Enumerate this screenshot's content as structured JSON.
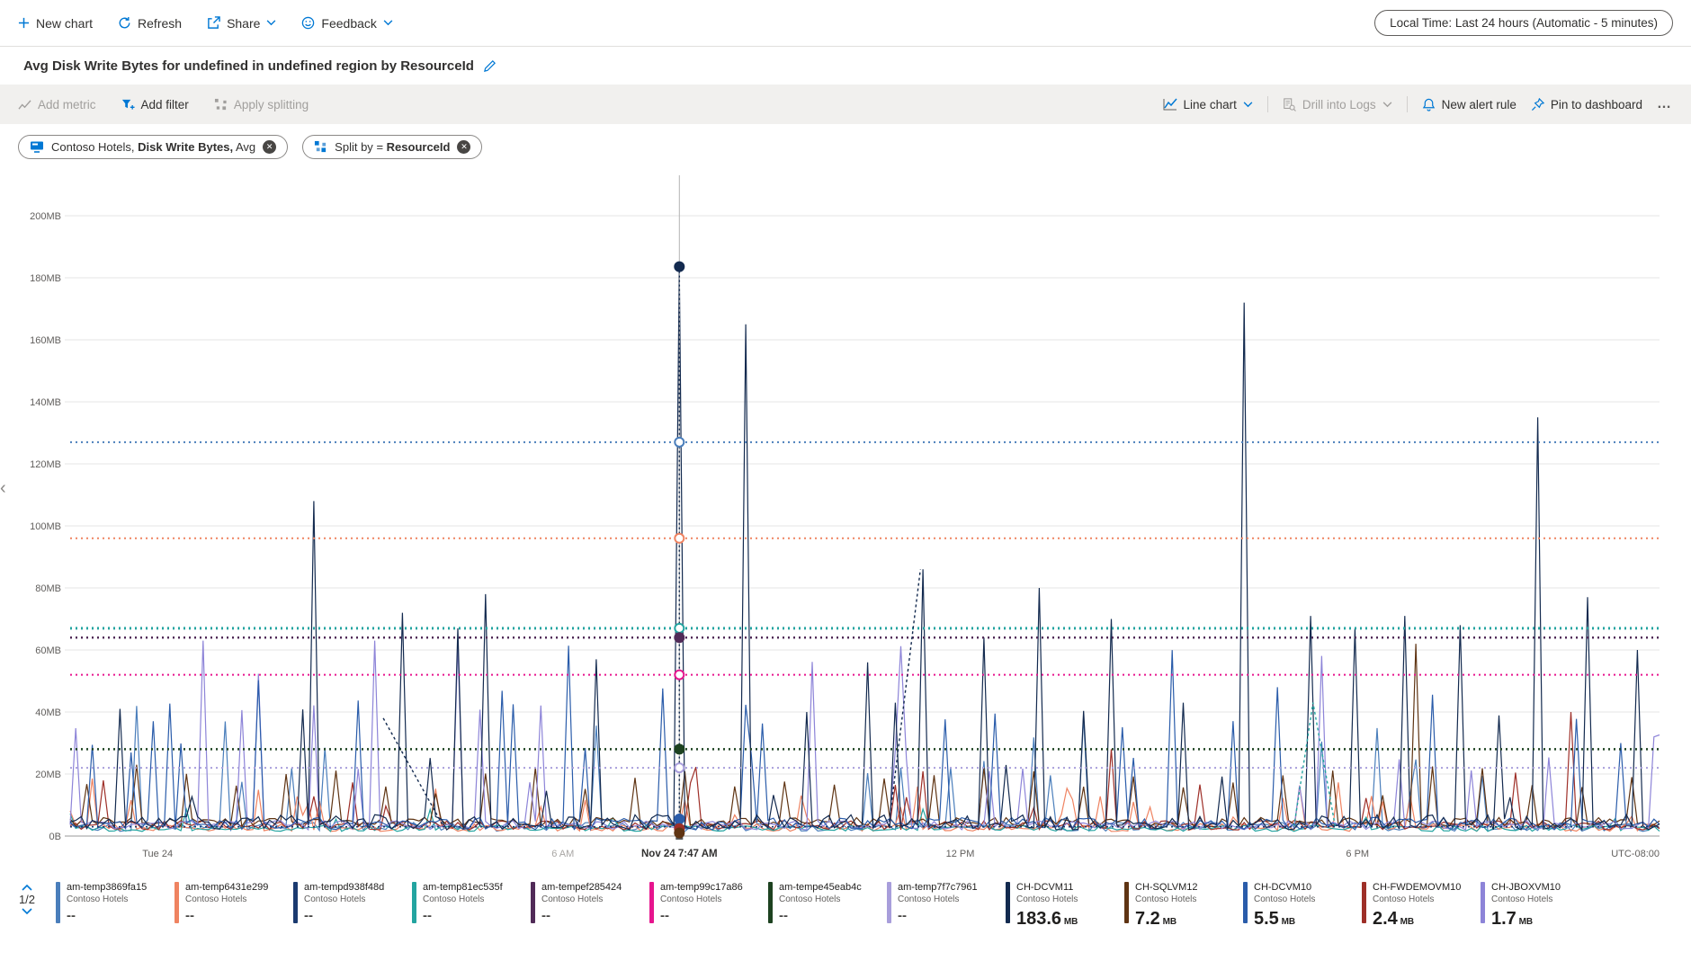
{
  "toolbar": {
    "new_chart": "New chart",
    "refresh": "Refresh",
    "share": "Share",
    "feedback": "Feedback",
    "time_range": "Local Time: Last 24 hours (Automatic - 5 minutes)"
  },
  "title": "Avg Disk Write Bytes for undefined in undefined region by ResourceId",
  "chart_toolbar": {
    "add_metric": "Add metric",
    "add_filter": "Add filter",
    "apply_splitting": "Apply splitting",
    "chart_type": "Line chart",
    "drill_into_logs": "Drill into Logs",
    "new_alert_rule": "New alert rule",
    "pin_to_dashboard": "Pin to dashboard",
    "more": "…"
  },
  "filters": {
    "metric_pill": {
      "scope": "Contoso Hotels,",
      "metric": "Disk Write Bytes,",
      "aggregation": "Avg"
    },
    "split_pill": {
      "label": "Split by",
      "operator": "=",
      "value": "ResourceId"
    }
  },
  "misc": {
    "left_chevron": "‹"
  },
  "chart_data": {
    "type": "line",
    "title": "Avg Disk Write Bytes for undefined in undefined region by ResourceId",
    "ylim": [
      0,
      200
    ],
    "grid": true,
    "y_ticks": [
      {
        "v": 0,
        "label": "0B"
      },
      {
        "v": 20,
        "label": "20MB"
      },
      {
        "v": 40,
        "label": "40MB"
      },
      {
        "v": 60,
        "label": "60MB"
      },
      {
        "v": 80,
        "label": "80MB"
      },
      {
        "v": 100,
        "label": "100MB"
      },
      {
        "v": 120,
        "label": "120MB"
      },
      {
        "v": 140,
        "label": "140MB"
      },
      {
        "v": 160,
        "label": "160MB"
      },
      {
        "v": 180,
        "label": "180MB"
      },
      {
        "v": 200,
        "label": "200MB"
      }
    ],
    "x_ticks": [
      {
        "frac": 0.055,
        "label": "Tue 24",
        "muted": false
      },
      {
        "frac": 0.31,
        "label": "6 AM",
        "muted": true
      },
      {
        "frac": 0.56,
        "label": "12 PM",
        "muted": false
      },
      {
        "frac": 0.81,
        "label": "6 PM",
        "muted": false
      }
    ],
    "x_right_label": "UTC-08:00",
    "hover": {
      "frac": 0.3833,
      "label": "Nov 24 7:47 AM",
      "dots": [
        {
          "v": 183.6,
          "color": "#132a4f",
          "filled": true
        },
        {
          "v": 127,
          "color": "#4a7ebb",
          "filled": false
        },
        {
          "v": 96,
          "color": "#ef8361",
          "filled": false
        },
        {
          "v": 67,
          "color": "#23a4a0",
          "filled": false
        },
        {
          "v": 64,
          "color": "#512b58",
          "filled": true
        },
        {
          "v": 52,
          "color": "#e6158e",
          "filled": false
        },
        {
          "v": 28,
          "color": "#1d4220",
          "filled": true
        },
        {
          "v": 22,
          "color": "#a89edb",
          "filled": false
        },
        {
          "v": 5.5,
          "color": "#2a5caa",
          "filled": true
        },
        {
          "v": 2.4,
          "color": "#9e2f28",
          "filled": true
        },
        {
          "v": 1,
          "color": "#5f3413",
          "filled": true
        }
      ]
    },
    "dotted_levels": [
      {
        "v": 127,
        "color": "#4a7ebb",
        "w": 2
      },
      {
        "v": 96,
        "color": "#ef8361",
        "w": 2
      },
      {
        "v": 67,
        "color": "#23a4a0",
        "w": 3
      },
      {
        "v": 64,
        "color": "#512b58",
        "w": 2.5
      },
      {
        "v": 52,
        "color": "#e6158e",
        "w": 2
      },
      {
        "v": 28,
        "color": "#1d4220",
        "w": 2.5
      },
      {
        "v": 22,
        "color": "#a89edb",
        "w": 2
      },
      {
        "v": 3,
        "color": "#1b3a70",
        "w": 1.6
      }
    ],
    "solid_series": [
      {
        "name": "am-temp3869fa15",
        "color": "#4a7ebb",
        "seed": 88,
        "base": 1.5,
        "noise": 3,
        "spikeProb": 0.05,
        "spikeMin": 10,
        "spikeMax": 42,
        "events": []
      },
      {
        "name": "am-temp6431e299",
        "color": "#ef8361",
        "seed": 66,
        "base": 1.5,
        "noise": 2.5,
        "spikeProb": 0.07,
        "spikeMin": 5,
        "spikeMax": 19,
        "events": []
      },
      {
        "name": "am-temp81ec535f",
        "color": "#23a4a0",
        "seed": 77,
        "base": 1.5,
        "noise": 2,
        "spikeProb": 0.05,
        "spikeMin": 3,
        "spikeMax": 9,
        "events": []
      },
      {
        "name": "CH-FWDEMOVM10",
        "color": "#9e2f28",
        "seed": 55,
        "base": 2,
        "noise": 3,
        "spikeProb": 0.055,
        "spikeMin": 7,
        "spikeMax": 24,
        "events": [
          [
            0.945,
            40
          ],
          [
            0.655,
            28
          ]
        ]
      },
      {
        "name": "CH-SQLVM12",
        "color": "#5f3413",
        "seed": 44,
        "base": 3,
        "noise": 3,
        "spikeProb": 0,
        "period": 9,
        "periodMin": 13,
        "periodMax": 23,
        "events": [
          [
            0.845,
            62
          ]
        ]
      },
      {
        "name": "CH-JBOXVM10",
        "color": "#8d84d8",
        "seed": 33,
        "base": 2,
        "noise": 3,
        "spikeProb": 0.06,
        "spikeMin": 12,
        "spikeMax": 63,
        "events": [
          [
            0.085,
            63
          ],
          [
            0.19,
            63
          ],
          [
            0.58,
            21
          ]
        ]
      },
      {
        "name": "CH-DCVM10",
        "color": "#2a5caa",
        "seed": 22,
        "base": 2,
        "noise": 4,
        "spikeProb": 0.085,
        "spikeMin": 25,
        "spikeMax": 66,
        "events": [
          [
            0.975,
            30
          ]
        ]
      },
      {
        "name": "CH-DCVM11",
        "color": "#132a4f",
        "seed": 11,
        "base": 2,
        "noise": 5,
        "spikeProb": 0.03,
        "spikeMin": 10,
        "spikeMax": 45,
        "events": [
          [
            0.03,
            41
          ],
          [
            0.155,
            108
          ],
          [
            0.21,
            72
          ],
          [
            0.245,
            67
          ],
          [
            0.262,
            78
          ],
          [
            0.33,
            57
          ],
          [
            0.3833,
            183.6
          ],
          [
            0.425,
            165
          ],
          [
            0.465,
            40
          ],
          [
            0.5,
            56
          ],
          [
            0.535,
            86
          ],
          [
            0.575,
            64
          ],
          [
            0.61,
            80
          ],
          [
            0.655,
            70
          ],
          [
            0.7,
            43
          ],
          [
            0.74,
            172
          ],
          [
            0.78,
            71
          ],
          [
            0.81,
            67
          ],
          [
            0.84,
            71
          ],
          [
            0.875,
            68
          ],
          [
            0.925,
            135
          ],
          [
            0.955,
            77
          ],
          [
            0.985,
            60
          ]
        ]
      }
    ],
    "dashed_segments": [
      {
        "color": "#23a4a0",
        "points": [
          [
            0.77,
            3
          ],
          [
            0.782,
            43
          ],
          [
            0.796,
            3
          ]
        ]
      },
      {
        "color": "#132a4f",
        "points": [
          [
            0.197,
            38
          ],
          [
            0.235,
            3
          ]
        ]
      },
      {
        "color": "#132a4f",
        "points": [
          [
            0.515,
            3
          ],
          [
            0.535,
            86
          ]
        ]
      }
    ]
  },
  "legend": {
    "page": "1/2",
    "items": [
      {
        "name": "am-temp3869fa15",
        "company": "Contoso Hotels",
        "value": "--",
        "unit": "",
        "color": "#4a7ebb"
      },
      {
        "name": "am-temp6431e299",
        "company": "Contoso Hotels",
        "value": "--",
        "unit": "",
        "color": "#ef8361"
      },
      {
        "name": "am-tempd938f48d",
        "company": "Contoso Hotels",
        "value": "--",
        "unit": "",
        "color": "#1b3a70"
      },
      {
        "name": "am-temp81ec535f",
        "company": "Contoso Hotels",
        "value": "--",
        "unit": "",
        "color": "#23a4a0"
      },
      {
        "name": "am-tempef285424",
        "company": "Contoso Hotels",
        "value": "--",
        "unit": "",
        "color": "#512b58"
      },
      {
        "name": "am-temp99c17a86",
        "company": "Contoso Hotels",
        "value": "--",
        "unit": "",
        "color": "#e6158e"
      },
      {
        "name": "am-tempe45eab4c",
        "company": "Contoso Hotels",
        "value": "--",
        "unit": "",
        "color": "#1d4220"
      },
      {
        "name": "am-temp7f7c7961",
        "company": "Contoso Hotels",
        "value": "--",
        "unit": "",
        "color": "#a89edb"
      },
      {
        "name": "CH-DCVM11",
        "company": "Contoso Hotels",
        "value": "183.6",
        "unit": "MB",
        "color": "#132a4f"
      },
      {
        "name": "CH-SQLVM12",
        "company": "Contoso Hotels",
        "value": "7.2",
        "unit": "MB",
        "color": "#5f3413"
      },
      {
        "name": "CH-DCVM10",
        "company": "Contoso Hotels",
        "value": "5.5",
        "unit": "MB",
        "color": "#2a5caa"
      },
      {
        "name": "CH-FWDEMOVM10",
        "company": "Contoso Hotels",
        "value": "2.4",
        "unit": "MB",
        "color": "#9e2f28"
      },
      {
        "name": "CH-JBOXVM10",
        "company": "Contoso Hotels",
        "value": "1.7",
        "unit": "MB",
        "color": "#8d84d8"
      }
    ]
  }
}
